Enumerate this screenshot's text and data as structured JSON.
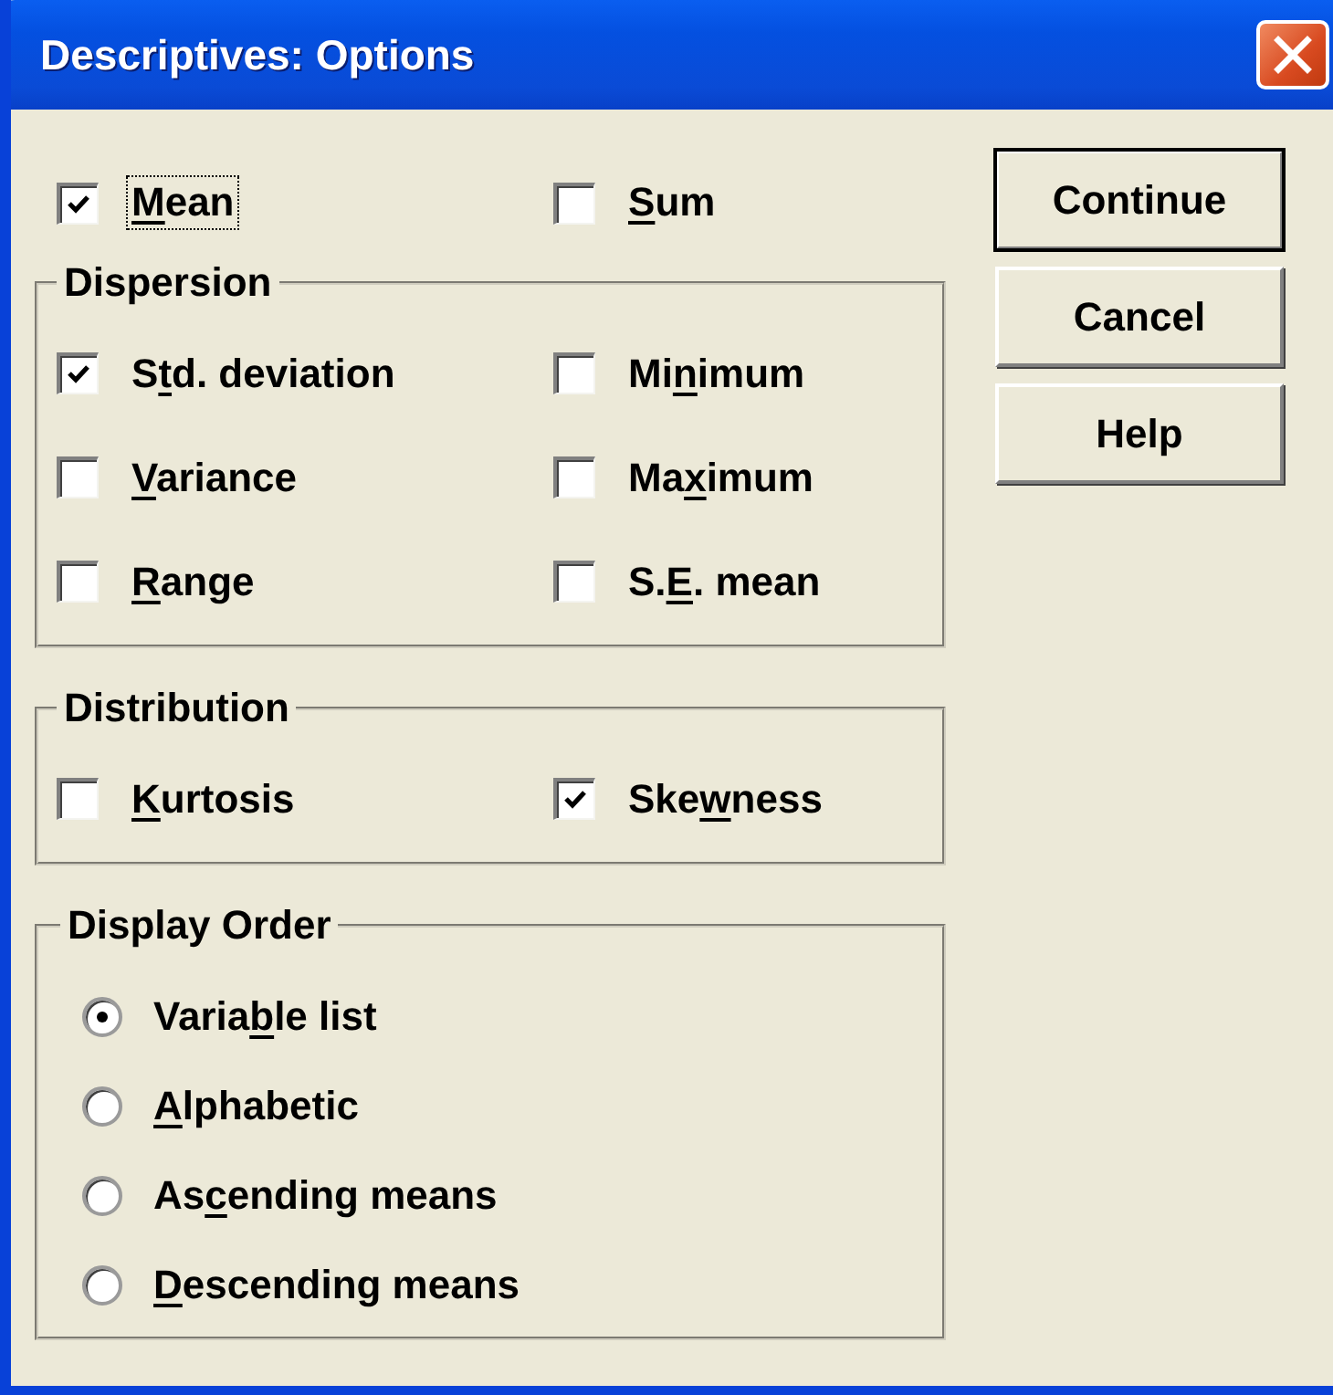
{
  "window": {
    "title": "Descriptives: Options"
  },
  "options": [
    {
      "key": "M",
      "post": "ean",
      "checked": true,
      "focused": true
    },
    {
      "key": "S",
      "post": "um",
      "checked": false,
      "focused": false
    }
  ],
  "groups": [
    {
      "title": "Dispersion",
      "kind": "checkboxes",
      "items": [
        {
          "pre": "S",
          "key": "t",
          "post": "d. deviation",
          "checked": true
        },
        {
          "pre": "Mi",
          "key": "n",
          "post": "imum",
          "checked": false
        },
        {
          "key": "V",
          "post": "ariance",
          "checked": false
        },
        {
          "pre": "Ma",
          "key": "x",
          "post": "imum",
          "checked": false
        },
        {
          "key": "R",
          "post": "ange",
          "checked": false
        },
        {
          "pre": "S.",
          "key": "E",
          "post": ". mean",
          "checked": false
        }
      ]
    },
    {
      "title": "Distribution",
      "kind": "checkboxes",
      "items": [
        {
          "key": "K",
          "post": "urtosis",
          "checked": false
        },
        {
          "pre": "Ske",
          "key": "w",
          "post": "ness",
          "checked": true
        }
      ]
    },
    {
      "title": "Display Order",
      "kind": "radios",
      "items": [
        {
          "pre": "Varia",
          "key": "b",
          "post": "le list",
          "selected": true
        },
        {
          "key": "A",
          "post": "lphabetic",
          "selected": false
        },
        {
          "pre": "As",
          "key": "c",
          "post": "ending means",
          "selected": false
        },
        {
          "key": "D",
          "post": "escending means",
          "selected": false
        }
      ]
    }
  ],
  "buttons": [
    {
      "label": "Continue",
      "default": true
    },
    {
      "label": "Cancel",
      "default": false
    },
    {
      "label": "Help",
      "default": false
    }
  ]
}
